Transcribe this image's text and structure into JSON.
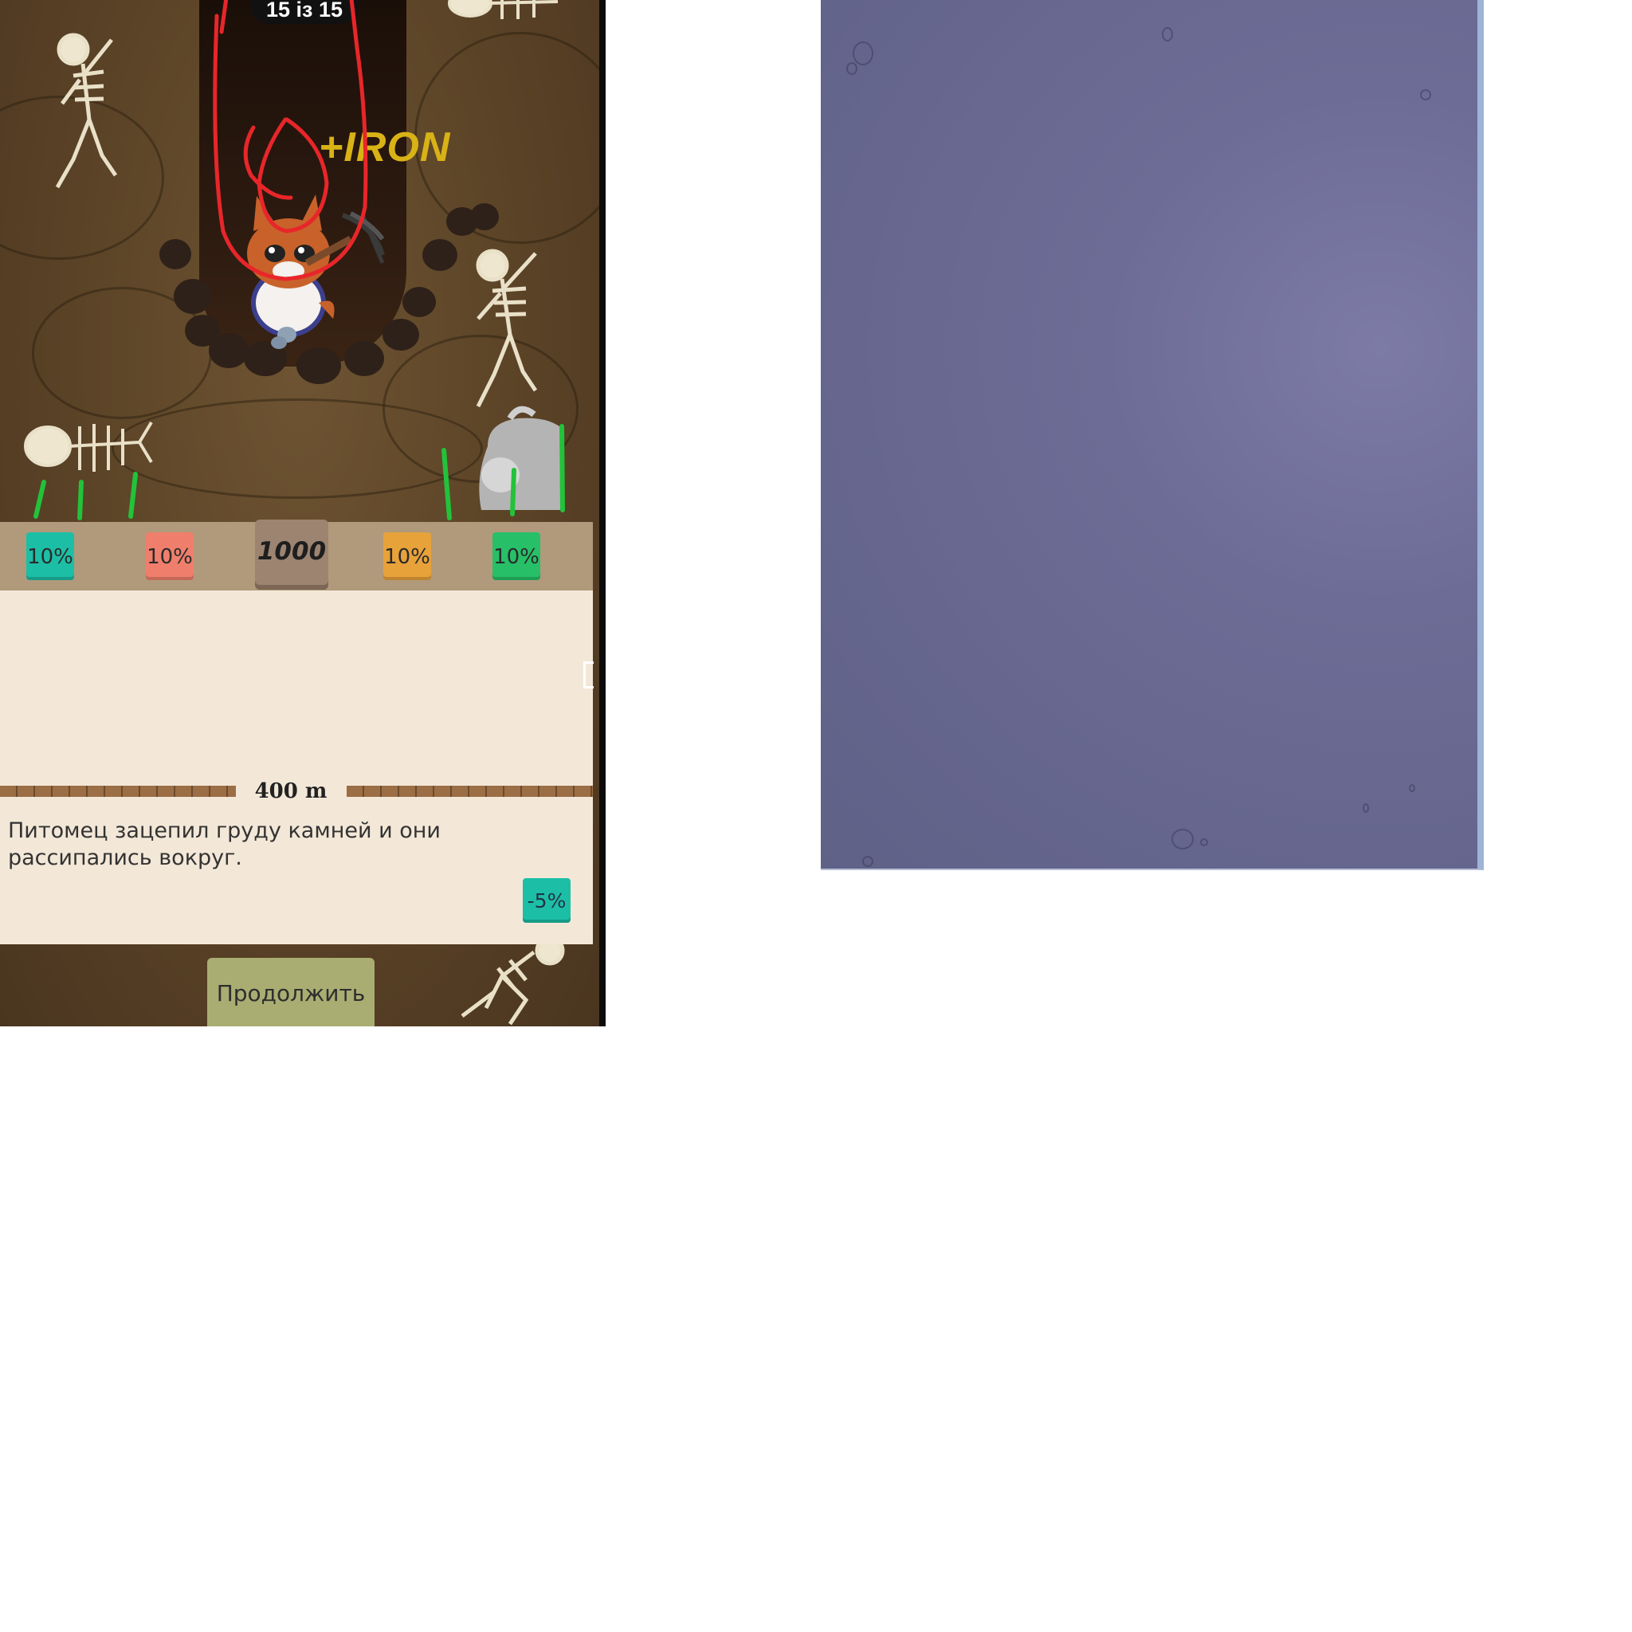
{
  "game": {
    "counter": "15 із 15",
    "floating_text": "+IRON",
    "resources": [
      {
        "label": "10%",
        "color": "#1cbfa6"
      },
      {
        "label": "10%",
        "color": "#ef7f6c"
      },
      {
        "label": "10%",
        "color": "#e8a23a"
      },
      {
        "label": "10%",
        "color": "#27c068"
      }
    ],
    "score": "1000",
    "depth": "400 m",
    "event_text": "Питомец зацепил груду камней и они рассипались вокруг.",
    "effect": "-5%",
    "continue_label": "Продолжить"
  },
  "annotations": {
    "red_scribble_color": "#e8262a",
    "green_tick_color": "#22c23a"
  },
  "blue_panel": {
    "color": "#6d6c96"
  }
}
